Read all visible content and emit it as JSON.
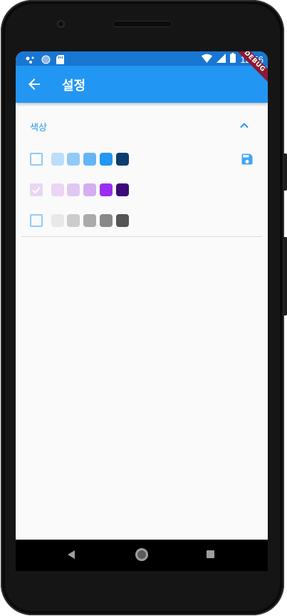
{
  "status_bar": {
    "time": "12:56",
    "icons": [
      "notification-dots-icon",
      "sync-icon",
      "sd-card-icon",
      "wifi-icon",
      "signal-icon",
      "battery-icon"
    ],
    "background": "#1976d2"
  },
  "app_bar": {
    "title": "설정",
    "back_icon": "arrow-back-icon",
    "background": "#2196f3",
    "debug_banner": "DEBUG"
  },
  "section": {
    "title": "색상",
    "expanded_icon": "chevron-up-icon"
  },
  "color_rows": [
    {
      "checked": false,
      "swatches": [
        "#bbdefb",
        "#90caf9",
        "#64b5f6",
        "#2196f3",
        "#0d3b6e"
      ],
      "save_icon": "save-icon"
    },
    {
      "checked": true,
      "swatches": [
        "#ead5f3",
        "#e1c8f2",
        "#d3aef0",
        "#9a2ef0",
        "#3b0a78"
      ]
    },
    {
      "checked": false,
      "swatches": [
        "#e8e8e8",
        "#cccccc",
        "#aaaaaa",
        "#888888",
        "#555555"
      ]
    }
  ],
  "nav_bar": {
    "icons": [
      "nav-back-icon",
      "nav-home-icon",
      "nav-recents-icon"
    ]
  }
}
